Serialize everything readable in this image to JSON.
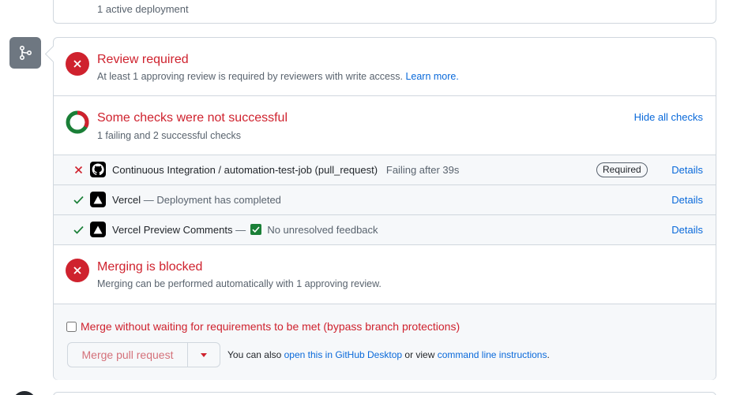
{
  "top_card": {
    "text": "1 active deployment"
  },
  "review": {
    "title": "Review required",
    "subtitle": "At least 1 approving review is required by reviewers with write access.",
    "learn_more": "Learn more."
  },
  "checks": {
    "title": "Some checks were not successful",
    "subtitle": "1 failing and 2 successful checks",
    "hide_all": "Hide all checks",
    "items": [
      {
        "status": "failure",
        "icon": "github-icon",
        "name": "Continuous Integration / automation-test-job (pull_request)",
        "description": "Failing after 39s",
        "badge": "Required",
        "details": "Details"
      },
      {
        "status": "success",
        "icon": "vercel-icon",
        "name": "Vercel",
        "description": "— Deployment has completed",
        "details": "Details"
      },
      {
        "status": "success",
        "icon": "vercel-icon",
        "name": "Vercel Preview Comments",
        "description_prefix": "—",
        "description": "No unresolved feedback",
        "details": "Details"
      }
    ]
  },
  "merge_blocked": {
    "title": "Merging is blocked",
    "subtitle": "Merging can be performed automatically with 1 approving review."
  },
  "actions": {
    "bypass_label": "Merge without waiting for requirements to be met (bypass branch protections)",
    "merge_button": "Merge pull request",
    "also_text": "You can also",
    "desktop_link": "open this in GitHub Desktop",
    "or_view": "or view",
    "cli_link": "command line instructions",
    "period": "."
  },
  "colors": {
    "danger": "#cf222e",
    "success": "#1a7f37",
    "link": "#0969da",
    "muted": "#59636e",
    "border": "#d0d7de"
  }
}
